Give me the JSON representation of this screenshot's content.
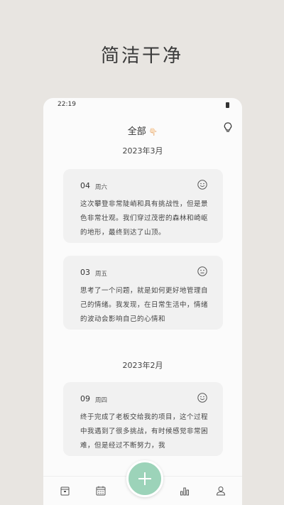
{
  "headline": "简洁干净",
  "status": {
    "time": "22:19"
  },
  "header": {
    "title": "全部",
    "title_emoji": "👇🏻"
  },
  "sections": [
    {
      "month": "2023年3月",
      "entries": [
        {
          "day": "04",
          "weekday": "周六",
          "mood": "smile-icon",
          "text": "这次攀登非常陡峭和具有挑战性，但是景色非常壮观。我们穿过茂密的森林和崎岖的地形，最终到达了山顶。"
        },
        {
          "day": "03",
          "weekday": "周五",
          "mood": "neutral-face-icon",
          "text": "思考了一个问题，就是如何更好地管理自己的情绪。我发现，在日常生活中，情绪的波动会影响自己的心情和"
        }
      ]
    },
    {
      "month": "2023年2月",
      "entries": [
        {
          "day": "09",
          "weekday": "周四",
          "mood": "smile-icon",
          "text": "终于完成了老板交给我的项目，这个过程中我遇到了很多挑战，有时候感觉非常困难，但是经过不断努力，我"
        }
      ]
    }
  ],
  "tabbar": {
    "items": [
      {
        "icon": "archive-icon"
      },
      {
        "icon": "calendar-icon"
      },
      {
        "icon": "add-icon"
      },
      {
        "icon": "chart-icon"
      },
      {
        "icon": "profile-icon"
      }
    ]
  },
  "colors": {
    "accent": "#9cd3b9",
    "background": "#e8e5e1",
    "card": "#f1f1f1"
  }
}
